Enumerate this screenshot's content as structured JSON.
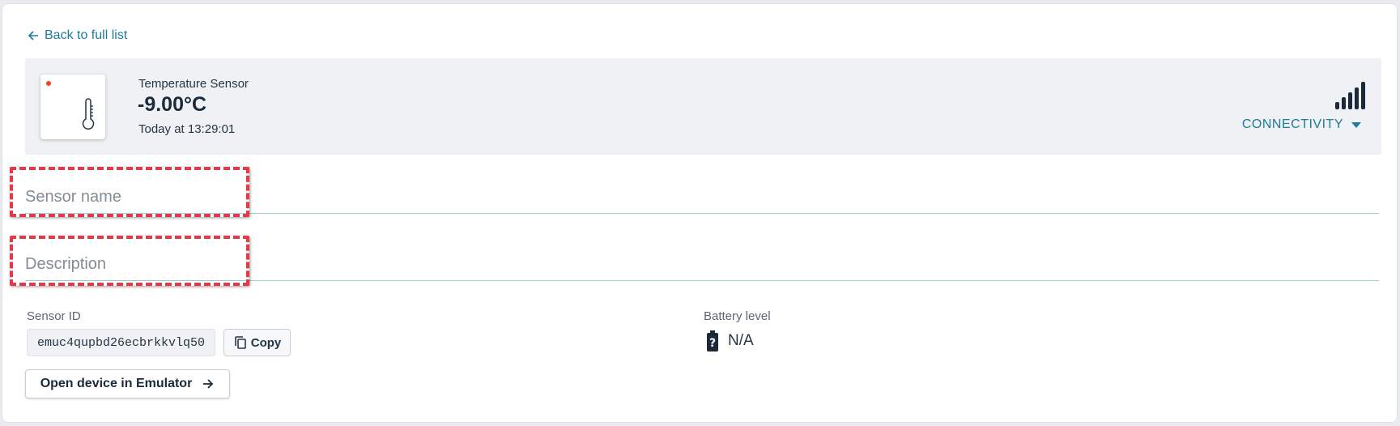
{
  "nav": {
    "back_label": "Back to full list"
  },
  "sensor": {
    "type": "Temperature Sensor",
    "value": "-9.00°C",
    "timestamp": "Today at 13:29:01",
    "status_color": "#f4431f",
    "icon": "thermometer-icon"
  },
  "connectivity": {
    "label": "CONNECTIVITY",
    "icon": "signal-bars-icon"
  },
  "form": {
    "name_placeholder": "Sensor name",
    "description_placeholder": "Description"
  },
  "details": {
    "id_label": "Sensor ID",
    "id_value": "emuc4qupbd26ecbrkkvlq50",
    "copy_label": "Copy",
    "battery_label": "Battery level",
    "battery_value": "N/A",
    "battery_icon": "battery-unknown-icon"
  },
  "actions": {
    "open_emulator_label": "Open device in Emulator"
  },
  "colors": {
    "accent": "#1f7a9c",
    "highlight": "#e23a4b"
  }
}
